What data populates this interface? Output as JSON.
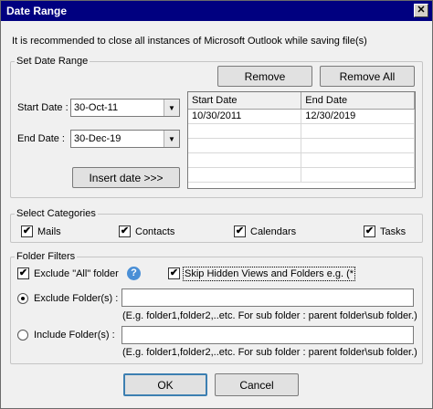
{
  "window": {
    "title": "Date Range",
    "close_glyph": "✕"
  },
  "note": "It is recommended to close all instances of Microsoft Outlook while saving file(s)",
  "date_range": {
    "legend": "Set Date Range",
    "remove_label": "Remove",
    "remove_all_label": "Remove All",
    "start_label": "Start Date :",
    "start_value": "30-Oct-11",
    "end_label": "End Date :",
    "end_value": "30-Dec-19",
    "insert_label": "Insert date >>>",
    "table": {
      "headers": [
        "Start Date",
        "End Date"
      ],
      "rows": [
        [
          "10/30/2011",
          "12/30/2019"
        ]
      ]
    }
  },
  "categories": {
    "legend": "Select Categories",
    "items": [
      {
        "label": "Mails",
        "checked": true
      },
      {
        "label": "Contacts",
        "checked": true
      },
      {
        "label": "Calendars",
        "checked": true
      },
      {
        "label": "Tasks",
        "checked": true
      }
    ]
  },
  "filters": {
    "legend": "Folder Filters",
    "exclude_all_label": "Exclude \"All\" folder",
    "help_glyph": "?",
    "skip_hidden_label": "Skip Hidden Views and Folders e.g. (*",
    "exclude_folders_label": "Exclude Folder(s) :",
    "exclude_hint": "(E.g. folder1,folder2,..etc. For sub folder : parent folder\\sub folder.)",
    "include_folders_label": "Include Folder(s) :",
    "include_hint": "(E.g. folder1,folder2,..etc. For sub folder : parent folder\\sub folder.)",
    "exclude_value": "",
    "include_value": ""
  },
  "footer": {
    "ok_label": "OK",
    "cancel_label": "Cancel"
  },
  "icons": {
    "check": "✔",
    "dropdown": "▼"
  }
}
